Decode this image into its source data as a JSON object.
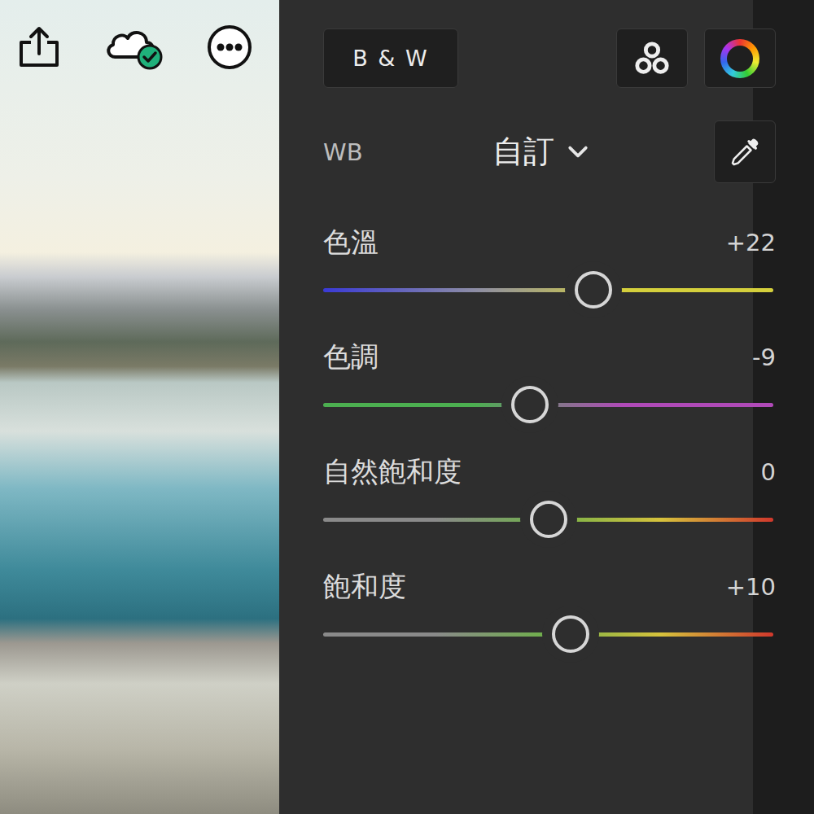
{
  "panel": {
    "bw_button": "B & W",
    "wb": {
      "label": "WB",
      "value": "自訂"
    },
    "sliders": [
      {
        "label": "色溫",
        "reading": "+22",
        "level": 0.6,
        "colors": [
          "#3a3ad6",
          "#8c8ca6",
          "#d4cf3c",
          "#d4cf3c"
        ]
      },
      {
        "label": "色調",
        "reading": "-9",
        "level": 0.46,
        "colors": [
          "#4caf50",
          "#4caf50",
          "#b04ab8",
          "#b04ab8"
        ]
      },
      {
        "label": "自然飽和度",
        "reading": "0",
        "level": 0.5,
        "colors": [
          "#8a8a8a",
          "#8a8a8a",
          "#6fb04a",
          "#d6c23c",
          "#d0382c"
        ]
      },
      {
        "label": "飽和度",
        "reading": "+10",
        "level": 0.55,
        "colors": [
          "#8a8a8a",
          "#8a8a8a",
          "#6fb04a",
          "#d6c23c",
          "#d0382c"
        ]
      }
    ]
  }
}
